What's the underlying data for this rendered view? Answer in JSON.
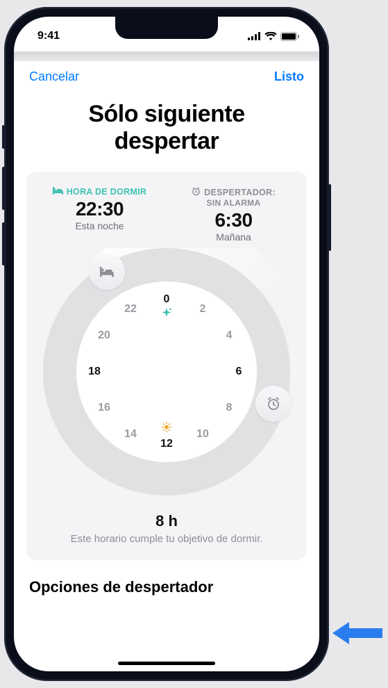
{
  "status": {
    "time": "9:41"
  },
  "nav": {
    "cancel": "Cancelar",
    "done": "Listo"
  },
  "title_line1": "Sólo siguiente",
  "title_line2": "despertar",
  "sleep_card": {
    "bedtime": {
      "label": "HORA DE DORMIR",
      "time": "22:30",
      "sub": "Esta noche"
    },
    "wake": {
      "label1": "DESPERTADOR:",
      "label2": "SIN ALARMA",
      "time": "6:30",
      "sub": "Mañana"
    },
    "hours": {
      "h0": "0",
      "h2": "2",
      "h4": "4",
      "h6": "6",
      "h8": "8",
      "h10": "10",
      "h12": "12",
      "h14": "14",
      "h16": "16",
      "h18": "18",
      "h20": "20",
      "h22": "22"
    },
    "duration": "8 h",
    "goal_text": "Este horario cumple tu objetivo de dormir."
  },
  "options_header": "Opciones de despertador",
  "colors": {
    "accent_teal": "#3dc2b3",
    "ios_blue": "#007aff"
  }
}
